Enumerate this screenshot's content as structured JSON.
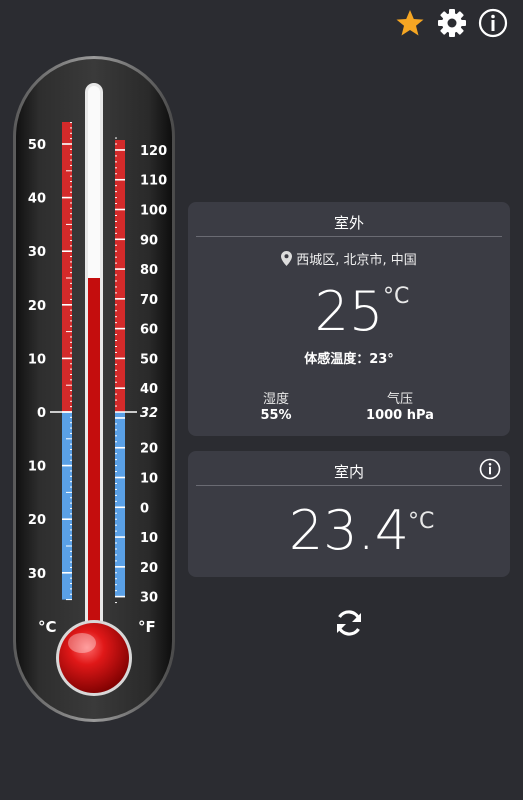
{
  "toolbar": {
    "star_icon": "star-icon",
    "settings_icon": "gear-icon",
    "info_icon": "info-icon"
  },
  "colors": {
    "background": "#2b2c31",
    "card": "#3b3c44",
    "mercury": "#cc1111",
    "star": "#f5a623"
  },
  "thermometer": {
    "celsius_labels": [
      "50",
      "40",
      "30",
      "20",
      "10",
      "0",
      "10",
      "20",
      "30"
    ],
    "fahrenheit_labels": [
      "120",
      "110",
      "100",
      "90",
      "80",
      "70",
      "60",
      "50",
      "40",
      "32",
      "20",
      "10",
      "0",
      "10",
      "20",
      "30"
    ],
    "celsius_unit": "°C",
    "fahrenheit_unit": "°F",
    "reading_celsius": 25
  },
  "outdoor": {
    "title": "室外",
    "location": "西城区, 北京市, 中国",
    "temperature": "25",
    "unit": "°C",
    "feels_like": "体感温度：23°",
    "humidity_label": "湿度",
    "humidity_value": "55%",
    "pressure_label": "气压",
    "pressure_value": "1000 hPa"
  },
  "indoor": {
    "title": "室内",
    "temperature": "23.4",
    "unit": "°C"
  }
}
